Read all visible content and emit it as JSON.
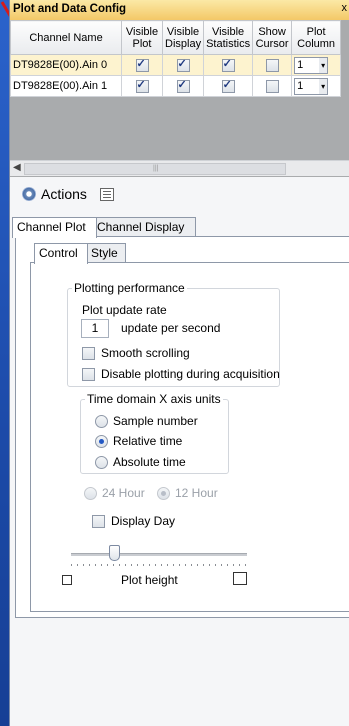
{
  "panel": {
    "title": "Plot and Data Config",
    "close_glyph": "x"
  },
  "grid": {
    "headers": {
      "channel_name": "Channel Name",
      "visible_plot": [
        "Visible",
        "Plot"
      ],
      "visible_display": [
        "Visible",
        "Display"
      ],
      "visible_statistics": [
        "Visible",
        "Statistics"
      ],
      "show_cursor": [
        "Show",
        "Cursor"
      ],
      "plot_column": [
        "Plot",
        "Column"
      ]
    },
    "rows": [
      {
        "channel": "DT9828E(00).Ain 0",
        "visible_plot": true,
        "visible_display": true,
        "visible_statistics": true,
        "show_cursor": false,
        "plot_column": "1",
        "selected": true
      },
      {
        "channel": "DT9828E(00).Ain 1",
        "visible_plot": true,
        "visible_display": true,
        "visible_statistics": true,
        "show_cursor": false,
        "plot_column": "1",
        "selected": false
      }
    ]
  },
  "actions": {
    "label": "Actions"
  },
  "tabs": [
    "Channel Plot",
    "Channel Display"
  ],
  "subtabs": [
    "Control",
    "Style"
  ],
  "plotting_performance": {
    "legend": "Plotting performance",
    "rate_label": "Plot update rate",
    "rate_value": "1",
    "rate_unit": "update per second",
    "smooth_scrolling": "Smooth scrolling",
    "smooth_scrolling_checked": false,
    "disable_plotting": "Disable plotting during acquisition",
    "disable_plotting_checked": false
  },
  "time_domain": {
    "legend": "Time domain X axis units",
    "options": [
      "Sample number",
      "Relative time",
      "Absolute time"
    ],
    "selected": "Relative time"
  },
  "hour_format": {
    "options": [
      "24 Hour",
      "12 Hour"
    ],
    "selected": "12 Hour",
    "enabled": false
  },
  "display_day": {
    "label": "Display Day",
    "checked": false
  },
  "plot_height": {
    "label": "Plot height",
    "slider_level": 0.25
  },
  "colors": {
    "title_bar": "#f3c867",
    "selected_row": "#fdf3cf",
    "desktop": "#1b4fb0"
  }
}
